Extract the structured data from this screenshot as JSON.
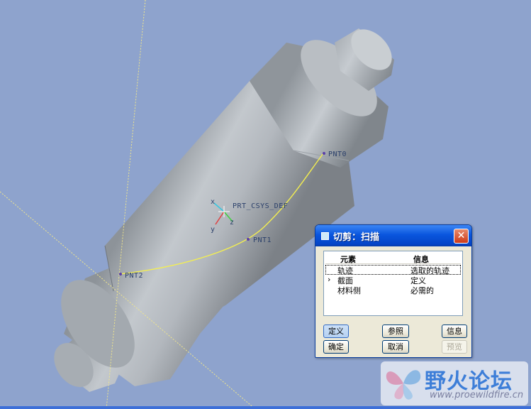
{
  "window": {
    "title": "切剪：扫描",
    "close_glyph": "✕"
  },
  "model": {
    "csys_label": "PRT_CSYS_DEF",
    "points": [
      {
        "label": "PNT0"
      },
      {
        "label": "PNT1"
      },
      {
        "label": "PNT2"
      }
    ],
    "axis_glyphs": {
      "x": "x",
      "y": "y",
      "z": "z"
    }
  },
  "elements_table": {
    "headers": {
      "element": "元素",
      "info": "信息"
    },
    "rows": [
      {
        "marker": "",
        "element": "轨迹",
        "info": "选取的轨迹",
        "selected": true
      },
      {
        "marker": "›",
        "element": "截面",
        "info": "定义",
        "selected": false
      },
      {
        "marker": "",
        "element": "材料侧",
        "info": "必需的",
        "selected": false
      }
    ]
  },
  "buttons": {
    "define": "定义",
    "refs": "参照",
    "info": "信息",
    "ok": "确定",
    "cancel": "取消",
    "preview": "预览"
  },
  "watermark": {
    "title": "野火论坛",
    "url": "www.proewildfire.cn"
  },
  "colors": {
    "background": "#8ea3cd",
    "trajectory": "#f4ef50",
    "title_bar": "#0a56de",
    "close_button": "#cd3b19"
  }
}
